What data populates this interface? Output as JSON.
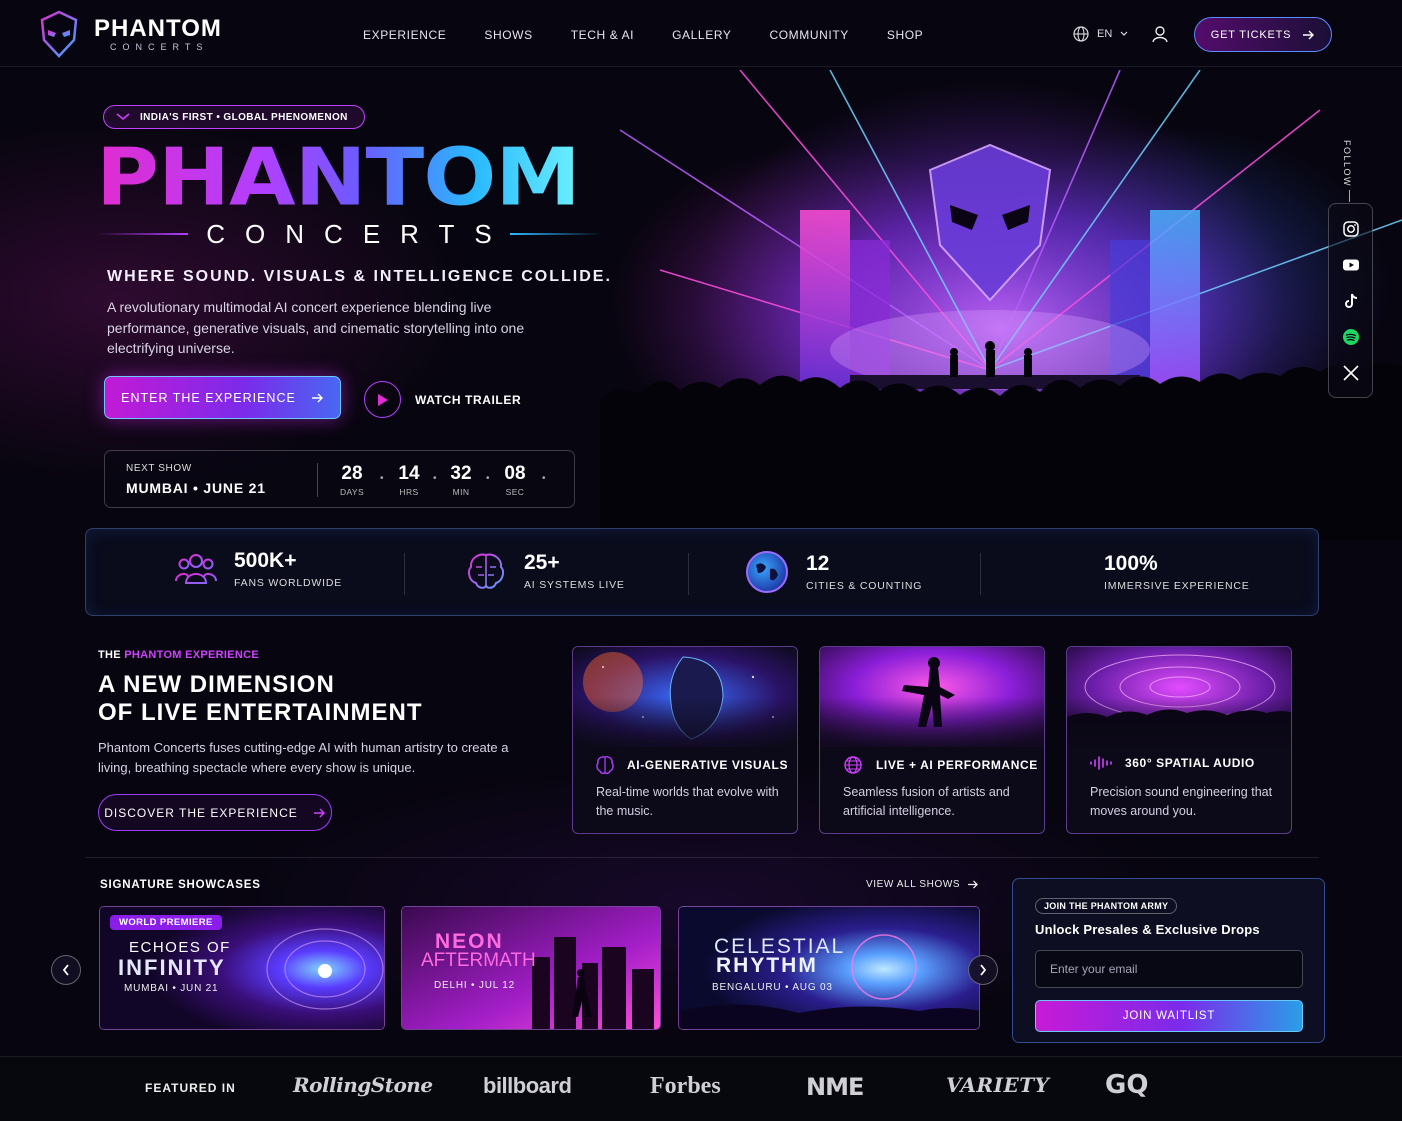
{
  "brand": {
    "name": "PHANTOM",
    "sub": "CONCERTS"
  },
  "nav": [
    "EXPERIENCE",
    "SHOWS",
    "TECH & AI",
    "GALLERY",
    "COMMUNITY",
    "SHOP"
  ],
  "header": {
    "lang": "EN",
    "tickets_label": "GET TICKETS"
  },
  "hero": {
    "badge": "INDIA'S FIRST • GLOBAL PHENOMENON",
    "title": "PHANTOM",
    "subtitle": "CONCERTS",
    "tagline": "WHERE SOUND. VISUALS & INTELLIGENCE COLLIDE.",
    "description": "A revolutionary multimodal AI concert experience blending live performance, generative visuals, and cinematic storytelling into one electrifying universe.",
    "enter_label": "ENTER THE EXPERIENCE",
    "trailer_label": "WATCH TRAILER"
  },
  "countdown": {
    "label": "NEXT SHOW",
    "city": "MUMBAI • JUNE 21",
    "units": [
      {
        "value": "28",
        "unit": "DAYS"
      },
      {
        "value": "14",
        "unit": "HRS"
      },
      {
        "value": "32",
        "unit": "MIN"
      },
      {
        "value": "08",
        "unit": "SEC"
      }
    ]
  },
  "social": {
    "follow": "FOLLOW",
    "icons": [
      "instagram-icon",
      "youtube-icon",
      "tiktok-icon",
      "spotify-icon",
      "x-icon"
    ]
  },
  "stats": [
    {
      "value": "500K+",
      "label": "FANS WORLDWIDE",
      "icon": "people-icon"
    },
    {
      "value": "25+",
      "label": "AI SYSTEMS LIVE",
      "icon": "brain-icon"
    },
    {
      "value": "12",
      "label": "CITIES & COUNTING",
      "icon": "globe-icon"
    },
    {
      "value": "100%",
      "label": "IMMERSIVE EXPERIENCE",
      "icon": "soundwave-icon"
    }
  ],
  "experience": {
    "eyebrow_prefix": "THE",
    "eyebrow_accent": "PHANTOM EXPERIENCE",
    "title_line1": "A NEW DIMENSION",
    "title_line2": "OF LIVE ENTERTAINMENT",
    "description": "Phantom Concerts fuses cutting-edge AI with human artistry to create a living, breathing spectacle where every show is unique.",
    "cta": "DISCOVER THE EXPERIENCE",
    "cards": [
      {
        "title": "AI-GENERATIVE VISUALS",
        "text": "Real-time worlds that evolve with the music."
      },
      {
        "title": "LIVE + AI PERFORMANCE",
        "text": "Seamless fusion of artists and artificial intelligence."
      },
      {
        "title": "360° SPATIAL AUDIO",
        "text": "Precision sound engineering that moves around you."
      }
    ]
  },
  "showcases": {
    "heading": "SIGNATURE SHOWCASES",
    "view_all": "VIEW ALL SHOWS",
    "items": [
      {
        "badge": "WORLD PREMIERE",
        "title1": "ECHOES OF",
        "title2": "INFINITY",
        "meta": "MUMBAI • JUN 21"
      },
      {
        "title1": "NEON",
        "title2": "AFTERMATH",
        "meta": "DELHI • JUL 12"
      },
      {
        "title1": "CELESTIAL",
        "title2": "RHYTHM",
        "meta": "BENGALURU • AUG 03"
      }
    ]
  },
  "waitlist": {
    "badge": "JOIN THE PHANTOM ARMY",
    "title": "Unlock Presales & Exclusive Drops",
    "placeholder": "Enter your email",
    "button": "JOIN WAITLIST"
  },
  "featured": {
    "label": "FEATURED IN",
    "publications": [
      "RollingStone",
      "billboard",
      "Forbes",
      "NME",
      "VARIETY",
      "GQ"
    ]
  },
  "colors": {
    "magenta": "#e02cd0",
    "purple": "#9d3cff",
    "cyan": "#2ab8ff",
    "bg": "#07050f"
  }
}
